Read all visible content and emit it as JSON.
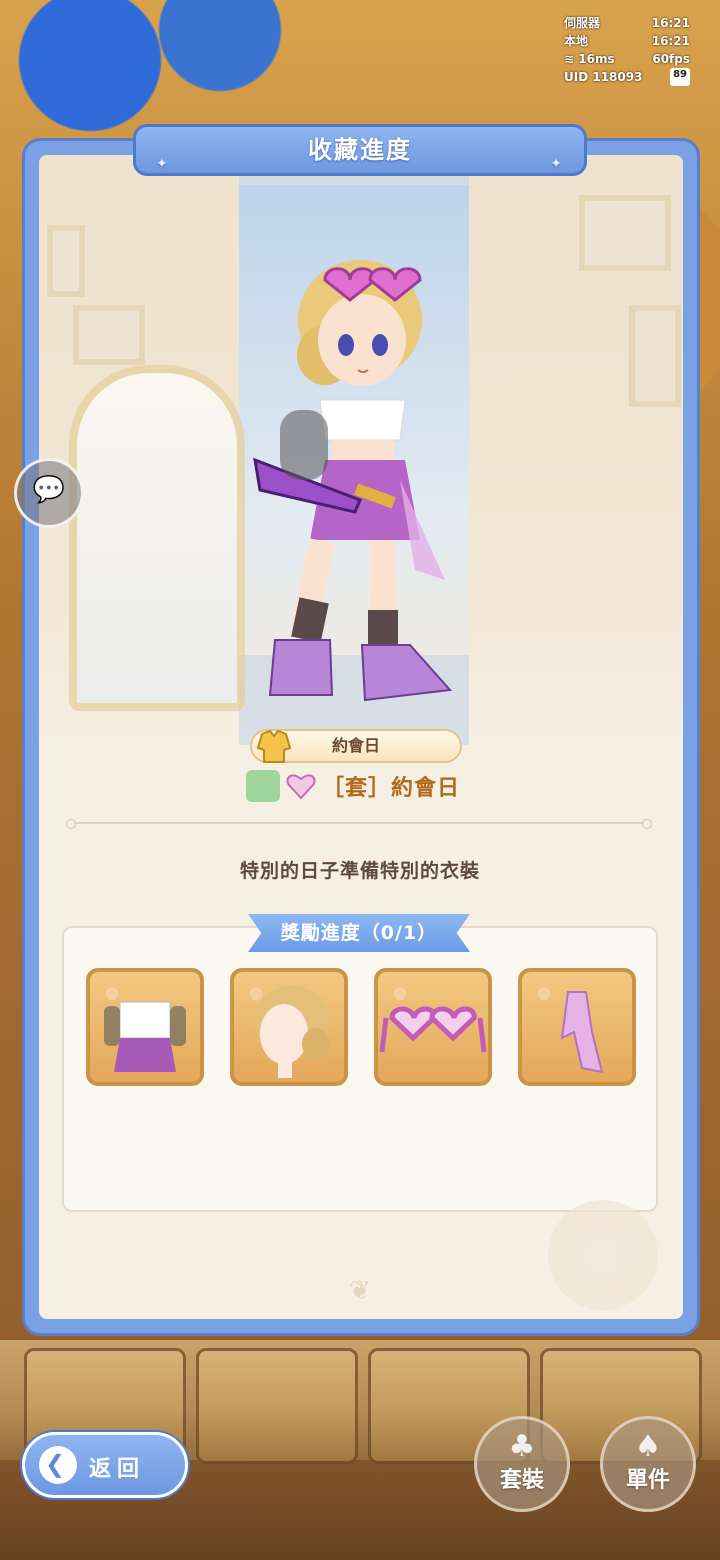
{
  "status": {
    "server_label": "伺服器",
    "server_time": "16:21",
    "local_label": "本地",
    "local_time": "16:21",
    "ping": "16ms",
    "fps": "60fps",
    "uid": "UID 118093",
    "battery": "89"
  },
  "panel": {
    "title": "收藏進度"
  },
  "outfit": {
    "name": "約會日",
    "set_text": "［套］約會日",
    "description": "特別的日子準備特別的衣裝"
  },
  "rewards": {
    "tab_label": "獎勵進度（0/1）",
    "items": [
      {
        "icon": "outfit-top-icon"
      },
      {
        "icon": "hair-icon"
      },
      {
        "icon": "heart-glasses-icon"
      },
      {
        "icon": "ribbon-icon"
      }
    ]
  },
  "bottom": {
    "back_label": "返回",
    "set_button": "套裝",
    "single_button": "單件"
  },
  "colors": {
    "panel_blue": "#7aa1e6",
    "accent_orange": "#b06a1e",
    "item_border": "#c99447"
  }
}
